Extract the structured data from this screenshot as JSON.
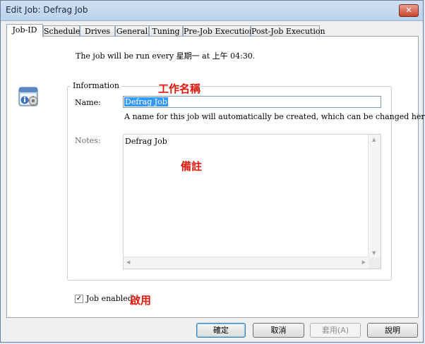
{
  "window": {
    "title": "Edit Job: Defrag Job",
    "close_symbol": "✕"
  },
  "tabs": [
    {
      "label": "Job-ID"
    },
    {
      "label": "Schedule"
    },
    {
      "label": "Drives"
    },
    {
      "label": "General"
    },
    {
      "label": "Tuning"
    },
    {
      "label": "Pre-Job Execution"
    },
    {
      "label": "Post-Job Execution"
    }
  ],
  "schedule_text": "The job will be run every 星期一 at 上午 04:30.",
  "information": {
    "group_label": "Information",
    "name_label": "Name:",
    "name_value": "Defrag Job",
    "name_hint": "A name for this job will automatically be created, which can be changed here.",
    "notes_label": "Notes:",
    "notes_value": "Defrag Job"
  },
  "annotations": {
    "name_annotation": "工作名稱",
    "notes_annotation": "備註",
    "enabled_annotation": "啟用"
  },
  "job_enabled": {
    "label": "Job enabled",
    "checked": true,
    "check_symbol": "✓"
  },
  "buttons": {
    "ok": "確定",
    "cancel": "取消",
    "apply": "套用(A)",
    "help": "說明"
  },
  "icons": {
    "app": "job-settings-icon"
  }
}
